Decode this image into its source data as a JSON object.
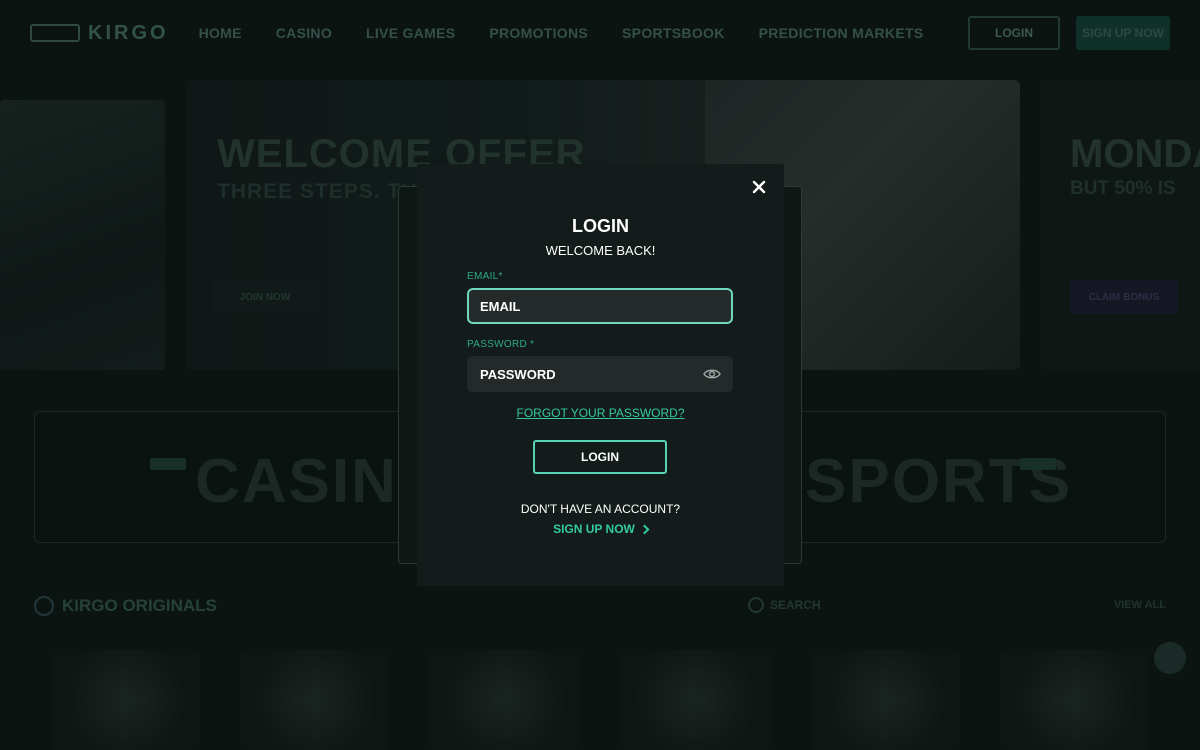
{
  "nav": {
    "logo_text": "KIRGO",
    "links": [
      "HOME",
      "CASINO",
      "LIVE GAMES",
      "PROMOTIONS",
      "SPORTSBOOK",
      "PREDICTION MARKETS"
    ],
    "login_label": "LOGIN",
    "signup_label": "SIGN UP NOW"
  },
  "hero": {
    "title": "WELCOME OFFER",
    "subtitle": "THREE STEPS. THREE BONUSES",
    "button": "JOIN NOW",
    "right_title": "MONDAY",
    "right_subtitle": "BUT 50% IS",
    "right_button": "CLAIM BONUS"
  },
  "banner": {
    "left": "CASINO",
    "right": "SPORTS"
  },
  "originals": {
    "title": "KIRGO ORIGINALS",
    "search": "SEARCH",
    "view_all": "VIEW ALL"
  },
  "modal": {
    "title": "LOGIN",
    "subtitle": "WELCOME BACK!",
    "email_label": "EMAIL",
    "email_placeholder": "EMAIL",
    "password_label": "PASSWORD",
    "password_placeholder": "PASSWORD",
    "required_mark": "*",
    "forgot": "FORGOT YOUR PASSWORD?",
    "submit": "LOGIN",
    "no_account": "DON'T HAVE AN ACCOUNT?",
    "signup": "SIGN UP NOW"
  },
  "colors": {
    "accent": "#35c9a1",
    "focus_border": "#6fd7bd",
    "modal_bg": "#131c1a",
    "input_bg": "#232a29"
  },
  "icons": [
    "close-icon",
    "eye-icon",
    "chevron-right-icon",
    "search-icon",
    "chat-icon"
  ]
}
